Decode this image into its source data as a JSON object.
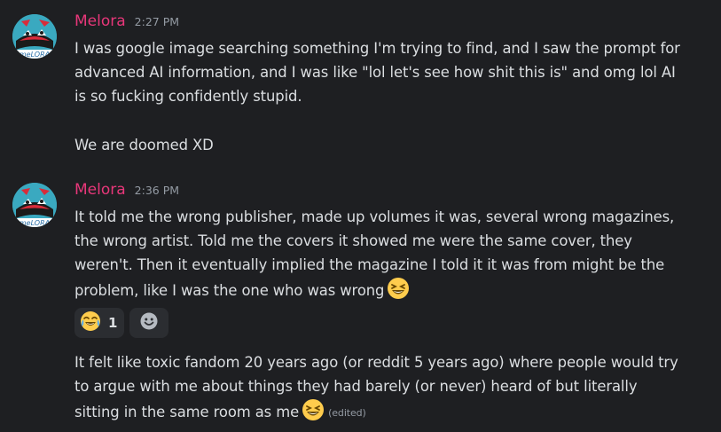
{
  "messages": [
    {
      "username": "Melora",
      "timestamp": "2:27 PM",
      "avatar_text": "meLORA",
      "lines": [
        "I was google image searching something I'm trying to find, and I saw the prompt for",
        "advanced AI information, and I was like \"lol let's see how shit this is\" and omg lol AI",
        "is so fucking confidently stupid."
      ],
      "followup_line": "We are doomed XD"
    },
    {
      "username": "Melora",
      "timestamp": "2:36 PM",
      "avatar_text": "meLORA",
      "lines": [
        "It told me the wrong publisher, made up volumes it was, several wrong magazines,",
        "the wrong artist. Told me the covers it showed me were the same cover, they",
        "weren't. Then it eventually implied the magazine I told it it was from might be the",
        "problem, like I was the one who was wrong"
      ],
      "end_emoji": "laughing-face",
      "reactions": [
        {
          "emoji": "joy-face",
          "count": "1"
        }
      ],
      "add_reaction_icon": "add-reaction-smiley"
    },
    {
      "lines": [
        "It felt like toxic fandom 20 years ago (or reddit 5 years ago) where people would try",
        "to argue with me about things they had barely (or never) heard of but literally",
        "sitting in the same room as me"
      ],
      "end_emoji": "laughing-face",
      "edited_label": "(edited)"
    }
  ],
  "colors": {
    "background": "#1e1f22",
    "username": "#e8377a",
    "timestamp": "#949ba4",
    "text": "#dbdee1",
    "reaction_bg": "#2b2d31",
    "avatar_bg": "#3aa9c0"
  }
}
